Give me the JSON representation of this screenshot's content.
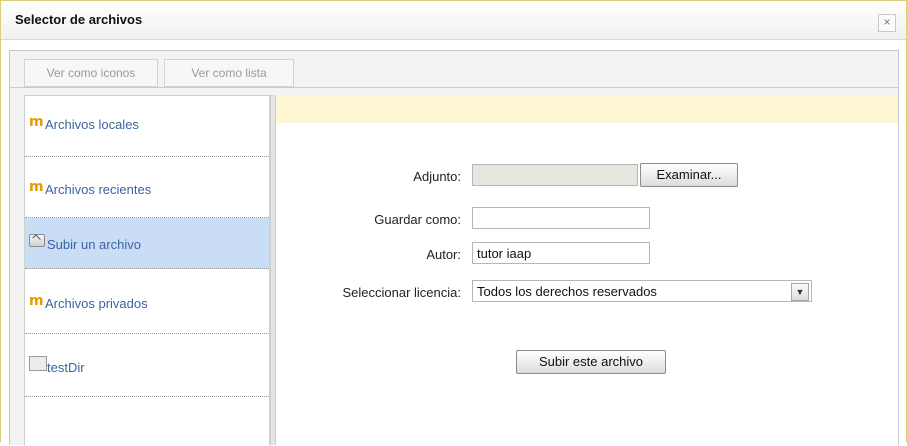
{
  "window": {
    "title": "Selector de archivos",
    "close_glyph": "×"
  },
  "toolbar": {
    "view_icons_label": "Ver como iconos",
    "view_list_label": "Ver como lista"
  },
  "sidebar": {
    "items": [
      {
        "label": "Archivos locales",
        "icon": "moodle-icon"
      },
      {
        "label": "Archivos recientes",
        "icon": "moodle-icon"
      },
      {
        "label": "Subir un archivo",
        "icon": "upload-icon",
        "active": true
      },
      {
        "label": "Archivos privados",
        "icon": "moodle-icon"
      },
      {
        "label": "testDir",
        "icon": "folder-icon"
      }
    ]
  },
  "form": {
    "attachment_label": "Adjunto:",
    "browse_label": "Examinar...",
    "save_as_label": "Guardar como:",
    "save_as_value": "",
    "author_label": "Autor:",
    "author_value": "tutor iaap",
    "license_label": "Seleccionar licencia:",
    "license_value": "Todos los derechos reservados",
    "submit_label": "Subir este archivo"
  },
  "colors": {
    "active_item": "#c9ddf6",
    "notice_bg": "#fdf6d3",
    "link": "#3b63a1",
    "moodle_orange": "#e79b00"
  }
}
